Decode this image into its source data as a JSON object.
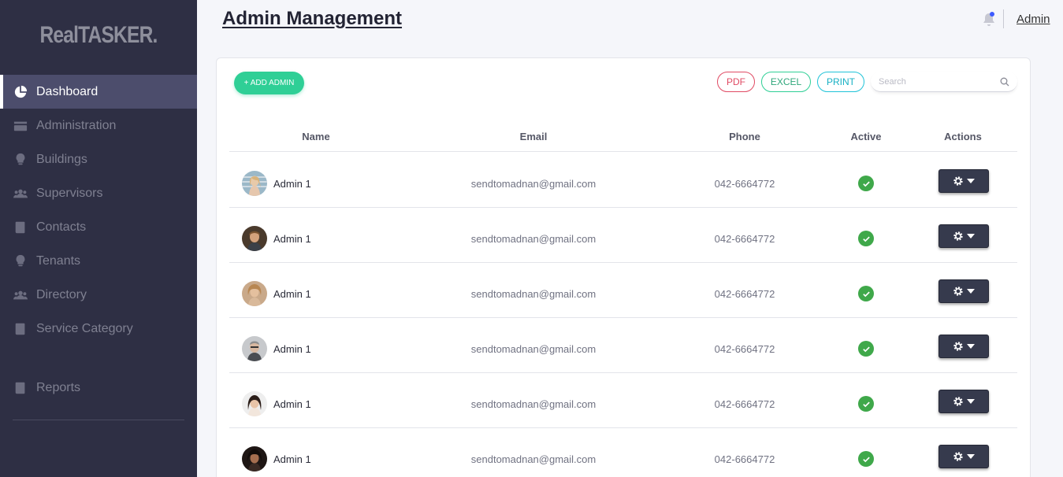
{
  "app": {
    "logo": "RealTASKER."
  },
  "sidebar": {
    "items": [
      {
        "label": "Dashboard",
        "icon": "pie-chart-icon",
        "active": true
      },
      {
        "label": "Administration",
        "icon": "card-icon"
      },
      {
        "label": "Buildings",
        "icon": "lightbulb-icon"
      },
      {
        "label": "Supervisors",
        "icon": "users-icon"
      },
      {
        "label": "Contacts",
        "icon": "book-icon"
      },
      {
        "label": "Tenants",
        "icon": "lightbulb-icon"
      },
      {
        "label": "Directory",
        "icon": "users-icon"
      },
      {
        "label": "Service Category",
        "icon": "book-icon"
      },
      {
        "label": "Reports",
        "icon": "book-icon"
      }
    ]
  },
  "header": {
    "title": "Admin Management",
    "user": "Admin",
    "bell_icon": "bell-icon"
  },
  "toolbar": {
    "add_label": "+ ADD ADMIN",
    "pdf_label": "PDF",
    "excel_label": "EXCEL",
    "print_label": "PRINT",
    "search_placeholder": "Search"
  },
  "table": {
    "headers": {
      "name": "Name",
      "email": "Email",
      "phone": "Phone",
      "active": "Active",
      "actions": "Actions"
    },
    "rows": [
      {
        "name": "Admin 1",
        "email": "sendtomadnan@gmail.com",
        "phone": "042-6664772",
        "active": true
      },
      {
        "name": "Admin 1",
        "email": "sendtomadnan@gmail.com",
        "phone": "042-6664772",
        "active": true
      },
      {
        "name": "Admin 1",
        "email": "sendtomadnan@gmail.com",
        "phone": "042-6664772",
        "active": true
      },
      {
        "name": "Admin 1",
        "email": "sendtomadnan@gmail.com",
        "phone": "042-6664772",
        "active": true
      },
      {
        "name": "Admin 1",
        "email": "sendtomadnan@gmail.com",
        "phone": "042-6664772",
        "active": true
      },
      {
        "name": "Admin 1",
        "email": "sendtomadnan@gmail.com",
        "phone": "042-6664772",
        "active": true
      }
    ]
  },
  "colors": {
    "sidebar_bg": "#2e2f44",
    "active_item_bg": "#4c4d6c",
    "add_button": "#2fcf96",
    "pdf": "#e04a63",
    "excel": "#2fcf96",
    "print": "#20c3d8",
    "active_check": "#3fa84a",
    "action_button": "#363a4d"
  }
}
